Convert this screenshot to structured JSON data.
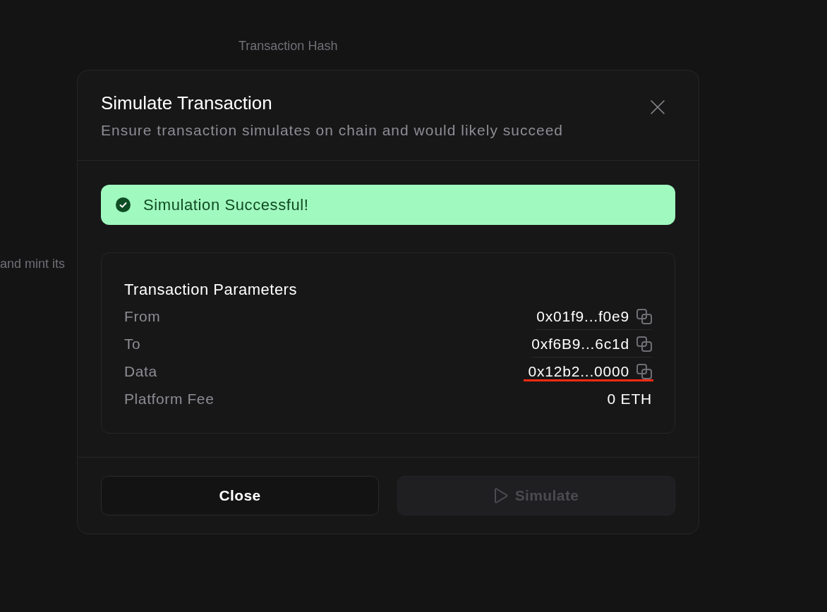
{
  "backdrop": {
    "texts": [
      "Transaction Hash",
      "and mint its"
    ]
  },
  "dialog": {
    "title": "Simulate Transaction",
    "subtitle": "Ensure transaction simulates on chain and would likely succeed"
  },
  "alert": {
    "kind": "success",
    "message": "Simulation Successful!"
  },
  "parameters": {
    "title": "Transaction Parameters",
    "rows": [
      {
        "label": "From",
        "value": "0x01f9...f0e9",
        "copyable": true,
        "annotated": false
      },
      {
        "label": "To",
        "value": "0xf6B9...6c1d",
        "copyable": true,
        "annotated": false
      },
      {
        "label": "Data",
        "value": "0x12b2...0000",
        "copyable": true,
        "annotated": true
      },
      {
        "label": "Platform Fee",
        "value": "0 ETH",
        "copyable": false,
        "annotated": false
      }
    ]
  },
  "buttons": [
    {
      "label": "Close",
      "kind": "secondary",
      "disabled": false
    },
    {
      "label": "Simulate",
      "kind": "primary",
      "disabled": true
    }
  ]
}
